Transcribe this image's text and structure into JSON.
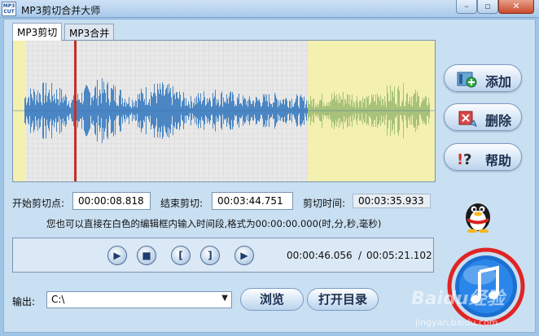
{
  "window": {
    "app_icon_text": "MP3 CUT",
    "title": "MP3剪切合并大师",
    "min_glyph": "–",
    "max_glyph": "▫",
    "close_glyph": "✕"
  },
  "tabs": [
    {
      "label": "MP3剪切"
    },
    {
      "label": "MP3合并"
    }
  ],
  "sidebar": {
    "add_label": "添加",
    "delete_label": "删除",
    "help_label": "帮助"
  },
  "times": {
    "start_label": "开始剪切点:",
    "start_value": "00:00:08.818",
    "end_label": "结束剪切:",
    "end_value": "00:03:44.751",
    "duration_label": "剪切时间:",
    "duration_value": "00:03:35.933"
  },
  "hint": "您也可以直接在白色的编辑框内输入时间段,格式为00:00:00.000(时,分,秒,毫秒)",
  "player": {
    "current_time": "00:00:46.056",
    "separator": "/",
    "total_time": "00:05:21.102",
    "play_glyph": "▶",
    "stop_glyph": "■",
    "mark_start_glyph": "[",
    "mark_end_glyph": "]",
    "play_selection_glyph": "▶"
  },
  "output": {
    "label": "输出:",
    "path": "C:\\",
    "browse_label": "浏览",
    "open_dir_label": "打开目录"
  },
  "watermark": {
    "text": "Baidu经验",
    "url_text": "jingyan.baidu.com"
  },
  "colors": {
    "selection": "#f3f0b0",
    "waveform": "#4a86c4",
    "waveform_outside": "#a8c27a",
    "cursor": "#c0302a",
    "brand_blue": "#1b6fd1",
    "ring_red": "#e02424"
  }
}
